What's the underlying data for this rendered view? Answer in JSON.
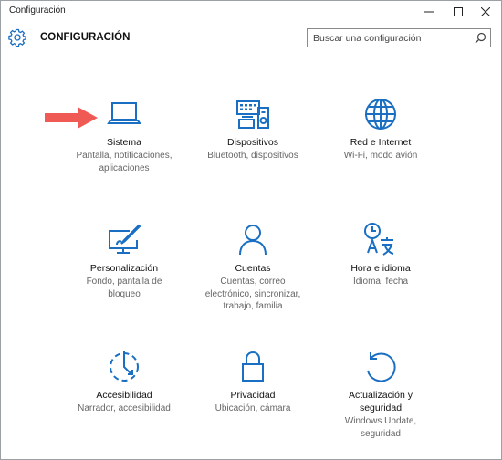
{
  "window": {
    "title": "Configuración"
  },
  "header": {
    "heading": "CONFIGURACIÓN",
    "search_placeholder": "Buscar una configuración"
  },
  "tiles": [
    {
      "name": "Sistema",
      "description": "Pantalla, notificaciones, aplicaciones",
      "icon": "laptop-icon"
    },
    {
      "name": "Dispositivos",
      "description": "Bluetooth, dispositivos",
      "icon": "devices-icon"
    },
    {
      "name": "Red e Internet",
      "description": "Wi-Fi, modo avión",
      "icon": "globe-icon"
    },
    {
      "name": "Personalización",
      "description": "Fondo, pantalla de bloqueo",
      "icon": "personalization-icon"
    },
    {
      "name": "Cuentas",
      "description": "Cuentas, correo electrónico, sincronizar, trabajo, familia",
      "icon": "person-icon"
    },
    {
      "name": "Hora e idioma",
      "description": "Idioma, fecha",
      "icon": "time-language-icon"
    },
    {
      "name": "Accesibilidad",
      "description": "Narrador, accesibilidad",
      "icon": "ease-of-access-icon"
    },
    {
      "name": "Privacidad",
      "description": "Ubicación, cámara",
      "icon": "lock-icon"
    },
    {
      "name": "Actualización y seguridad",
      "description": "Windows Update, seguridad",
      "icon": "update-icon"
    }
  ],
  "colors": {
    "accent": "#1a6fc2",
    "arrow": "#ef5a55"
  }
}
